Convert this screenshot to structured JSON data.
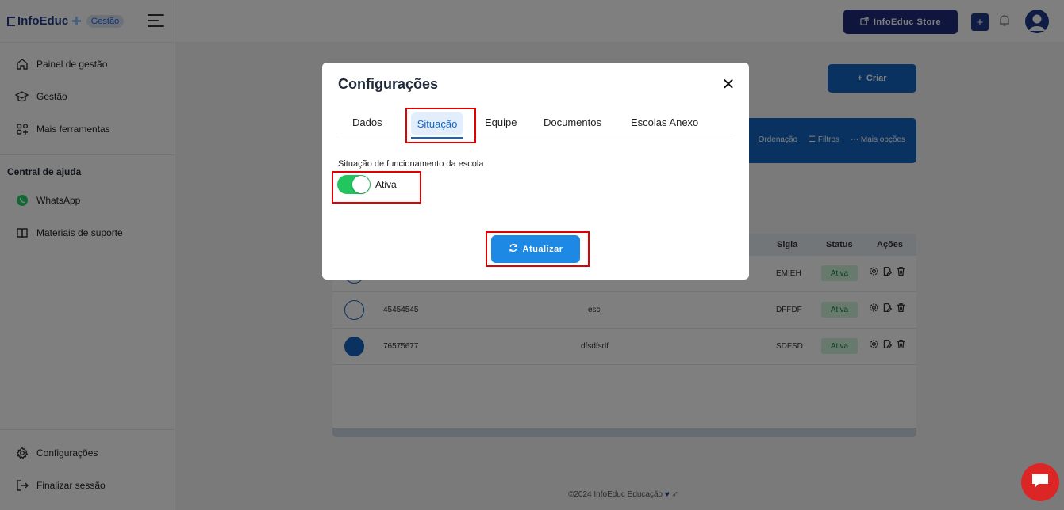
{
  "brand": {
    "name": "InfoEduc",
    "badge": "Gestão"
  },
  "sidebar": {
    "items": [
      {
        "label": "Painel de gestão",
        "icon": "home-icon"
      },
      {
        "label": "Gestão",
        "icon": "graduation-cap-icon"
      },
      {
        "label": "Mais ferramentas",
        "icon": "apps-icon"
      }
    ],
    "help_title": "Central de ajuda",
    "help_items": [
      {
        "label": "WhatsApp",
        "icon": "whatsapp-icon"
      },
      {
        "label": "Materiais de suporte",
        "icon": "book-icon"
      }
    ],
    "bottom_items": [
      {
        "label": "Configurações",
        "icon": "gear-icon"
      },
      {
        "label": "Finalizar sessão",
        "icon": "logout-icon"
      }
    ]
  },
  "topbar": {
    "store_label": "InfoEduc Store"
  },
  "main": {
    "criar_label": "Criar",
    "filter_options": [
      "Ordenação",
      "Filtros",
      "Mais opções"
    ],
    "table": {
      "headers": {
        "sigla": "Sigla",
        "status": "Status",
        "acoes": "Ações"
      },
      "rows": [
        {
          "code": "",
          "name": "",
          "sigla": "EMIEH",
          "status": "Ativa"
        },
        {
          "code": "45454545",
          "name": "esc",
          "sigla": "DFFDF",
          "status": "Ativa"
        },
        {
          "code": "76575677",
          "name": "dfsdfsdf",
          "sigla": "SDFSD",
          "status": "Ativa"
        }
      ]
    },
    "footer": "©2024 InfoEduc Educação"
  },
  "modal": {
    "title": "Configurações",
    "tabs": [
      "Dados",
      "Situação",
      "Equipe",
      "Documentos",
      "Escolas Anexo"
    ],
    "active_tab": "Situação",
    "section_label": "Situação de funcionamento da escola",
    "toggle_label": "Ativa",
    "toggle_on": true,
    "update_label": "Atualizar"
  },
  "colors": {
    "primary": "#1565c0",
    "toggle_on": "#22c55e",
    "highlight": "#e00000",
    "chat": "#dc2626"
  }
}
